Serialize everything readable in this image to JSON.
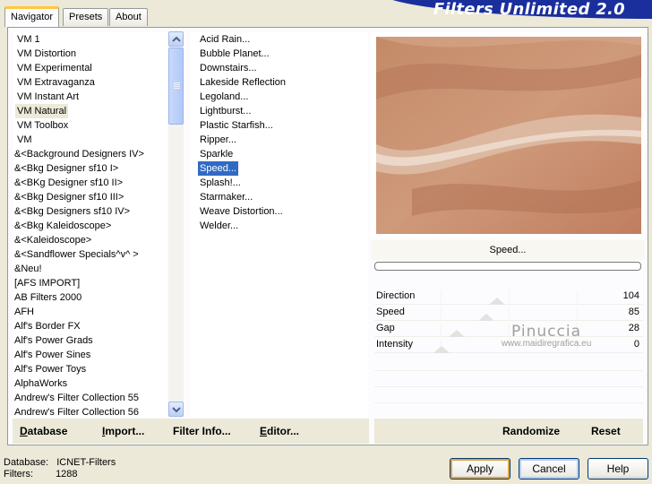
{
  "tabs": [
    "Navigator",
    "Presets",
    "About"
  ],
  "banner_title": "Filters Unlimited 2.0",
  "categories": {
    "items": [
      "VM 1",
      "VM Distortion",
      "VM Experimental",
      "VM Extravaganza",
      "VM Instant Art",
      "VM Natural",
      "VM Toolbox",
      "VM",
      "&<Background Designers IV>",
      "&<Bkg Designer sf10 I>",
      "&<BKg Designer sf10 II>",
      "&<Bkg Designer sf10 III>",
      "&<Bkg Designers sf10 IV>",
      "&<Bkg Kaleidoscope>",
      "&<Kaleidoscope>",
      "&<Sandflower Specials^v^ >",
      "&Neu!",
      "[AFS IMPORT]",
      "AB Filters 2000",
      "AFH",
      "Alf's Border FX",
      "Alf's Power Grads",
      "Alf's Power Sines",
      "Alf's Power Toys",
      "AlphaWorks",
      "Andrew's Filter Collection 55",
      "Andrew's Filter Collection 56"
    ],
    "selected_index": 5
  },
  "filters": {
    "items": [
      "Acid Rain...",
      "Bubble Planet...",
      "Downstairs...",
      "Lakeside Reflection",
      "Legoland...",
      "Lightburst...",
      "Plastic Starfish...",
      "Ripper...",
      "Sparkle",
      "Speed...",
      "Splash!...",
      "Starmaker...",
      "Weave Distortion...",
      "Welder..."
    ],
    "selected_index": 9
  },
  "preview": {
    "filter_name": "Speed...",
    "progress_percent": 0
  },
  "parameters": [
    {
      "name": "Direction",
      "value": "104",
      "slider_fraction": 0.41
    },
    {
      "name": "Speed",
      "value": "85",
      "slider_fraction": 0.33
    },
    {
      "name": "Gap",
      "value": "28",
      "slider_fraction": 0.11
    },
    {
      "name": "Intensity",
      "value": "0",
      "slider_fraction": 0
    }
  ],
  "watermark": {
    "line1": "Pinuccia",
    "line2": "www.maidiregrafica.eu"
  },
  "left_buttons": [
    {
      "underline": "D",
      "rest": "atabase"
    },
    {
      "underline": "I",
      "rest": "mport..."
    },
    {
      "underline": "",
      "rest": "Filter Info..."
    },
    {
      "underline": "E",
      "rest": "ditor..."
    }
  ],
  "right_buttons": {
    "randomize": "Randomize",
    "reset": "Reset"
  },
  "status": {
    "database_label": "Database:",
    "database_value": "ICNET-Filters",
    "filters_label": "Filters:",
    "filters_value": "1288"
  },
  "dialog_buttons": {
    "apply": "Apply",
    "cancel": "Cancel",
    "help": "Help"
  },
  "colors": {
    "selection": "#316ac5",
    "banner": "#1a2f9c",
    "tab_highlight": "#ffc83c"
  },
  "icons": {
    "scroll_up": "chevron-up-icon",
    "scroll_down": "chevron-down-icon"
  }
}
